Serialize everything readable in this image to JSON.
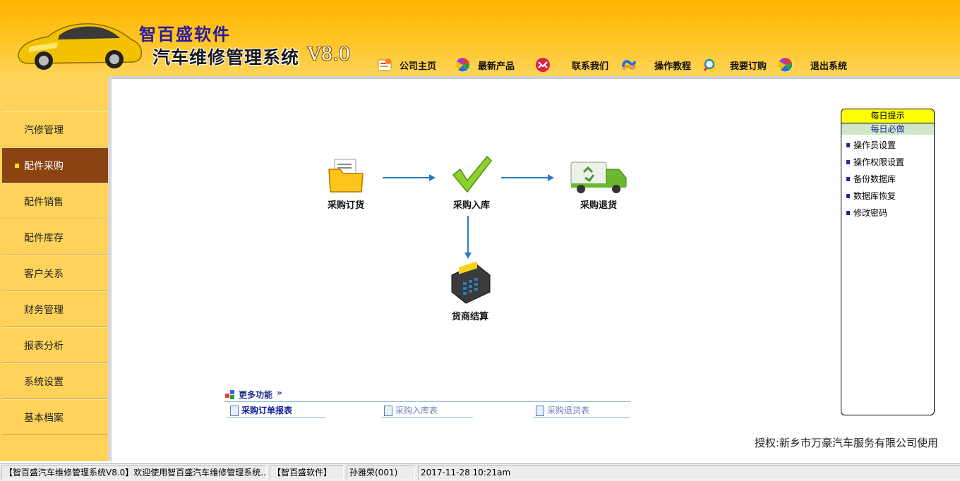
{
  "header": {
    "brand": "智百盛软件",
    "system_name": "汽车维修管理系统",
    "version": "V8.0"
  },
  "topnav": [
    {
      "label": "公司主页",
      "icon": "home-icon"
    },
    {
      "label": "最新产品",
      "icon": "product-icon"
    },
    {
      "label": "联系我们",
      "icon": "contact-icon"
    },
    {
      "label": "操作教程",
      "icon": "tutorial-icon"
    },
    {
      "label": "我要订购",
      "icon": "search-order-icon"
    },
    {
      "label": "退出系统",
      "icon": "exit-icon"
    }
  ],
  "sidebar": {
    "items": [
      {
        "label": "汽修管理"
      },
      {
        "label": "配件采购"
      },
      {
        "label": "配件销售"
      },
      {
        "label": "配件库存"
      },
      {
        "label": "客户关系"
      },
      {
        "label": "财务管理"
      },
      {
        "label": "报表分析"
      },
      {
        "label": "系统设置"
      },
      {
        "label": "基本档案"
      }
    ],
    "active_index": 1
  },
  "flow": {
    "order": "采购订货",
    "inbound": "采购入库",
    "return": "采购退货",
    "settle": "货商结算"
  },
  "more": {
    "title": "更多功能",
    "links": [
      "采购订单报表",
      "采购入库表",
      "采购退货表"
    ]
  },
  "tips": {
    "title": "每日提示",
    "subtitle": "每日必做",
    "items": [
      "操作员设置",
      "操作权限设置",
      "备份数据库",
      "数据库恢复",
      "修改密码"
    ]
  },
  "license": "授权:新乡市万豪汽车服务有限公司使用",
  "status": {
    "welcome": "【智百盛汽车维修管理系统V8.0】欢迎使用智百盛汽车维修管理系统...",
    "company": "【智百盛软件】",
    "user": "孙雅荣(001)",
    "datetime": "2017-11-28 10:21am"
  },
  "colors": {
    "header": "#ffb300",
    "sidebar": "#ffd35a",
    "active": "#8b4411",
    "arrow": "#2a7bc2"
  }
}
